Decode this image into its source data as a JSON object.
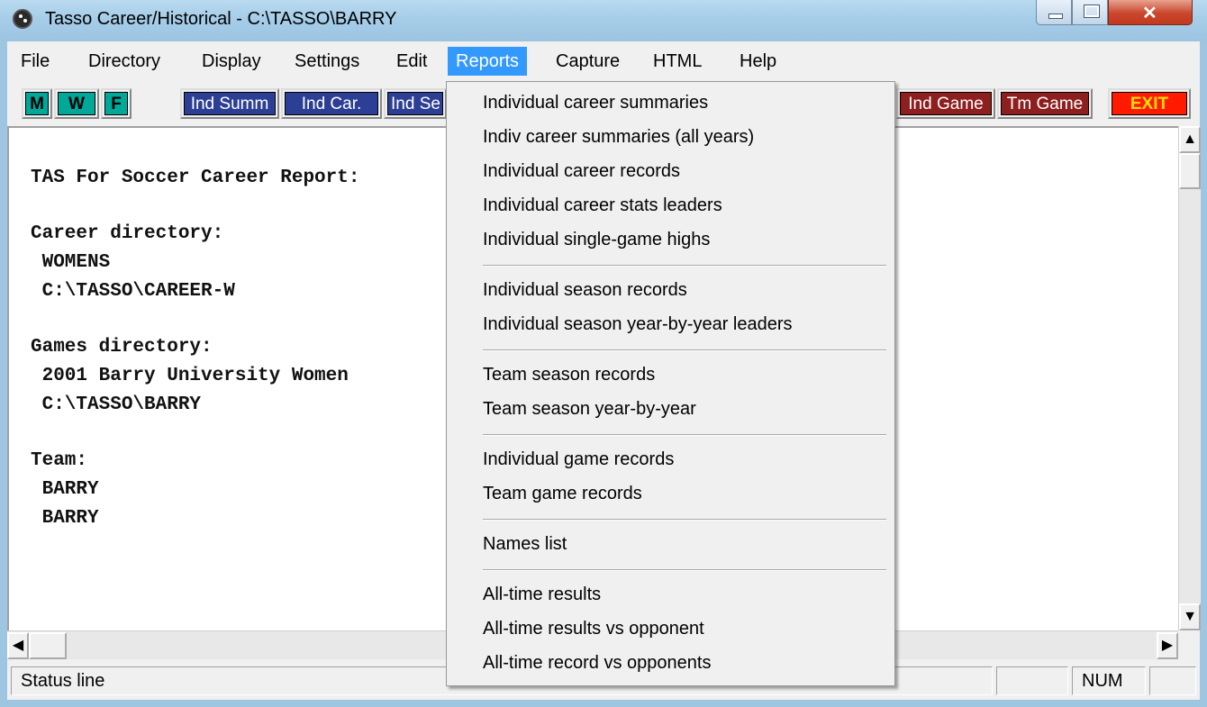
{
  "window": {
    "title": "Tasso Career/Historical - C:\\TASSO\\BARRY"
  },
  "menubar": [
    "File",
    "Directory",
    "Display",
    "Settings",
    "Edit",
    "Reports",
    "Capture",
    "HTML",
    "Help"
  ],
  "toolbar": {
    "buttons": [
      "M",
      "W",
      "F",
      "Ind Summ",
      "Ind Car.",
      "Ind Se",
      "Ind Game",
      "Tm Game",
      "EXIT"
    ]
  },
  "report_lines": [
    "TAS For Soccer Career Report:",
    "Career directory:",
    " WOMENS",
    " C:\\TASSO\\CAREER-W",
    "Games directory:",
    " 2001 Barry University Women",
    " C:\\TASSO\\BARRY",
    "Team:",
    " BARRY",
    " BARRY"
  ],
  "reports_menu": [
    "Individual career summaries",
    "Indiv career summaries (all years)",
    "Individual career records",
    "Individual career stats leaders",
    "Individual single-game highs",
    "Individual season records",
    "Individual season year-by-year leaders",
    "Team season records",
    "Team season year-by-year",
    "Individual game records",
    "Team game records",
    "Names list",
    "All-time results",
    "All-time results vs opponent",
    "All-time record vs opponents"
  ],
  "statusbar": {
    "text": "Status line",
    "num": "NUM"
  },
  "colors": {
    "teal": "#00a89a",
    "navy": "#2c3f94",
    "maroon": "#8e1f1f",
    "exit": "#ff1a00",
    "menu_highlight": "#3399ff"
  },
  "icons": {
    "app": "soccer-ball-icon",
    "scroll_up": "arrow-up-icon",
    "scroll_down": "arrow-down-icon",
    "scroll_left": "arrow-left-icon",
    "scroll_right": "arrow-right-icon"
  }
}
